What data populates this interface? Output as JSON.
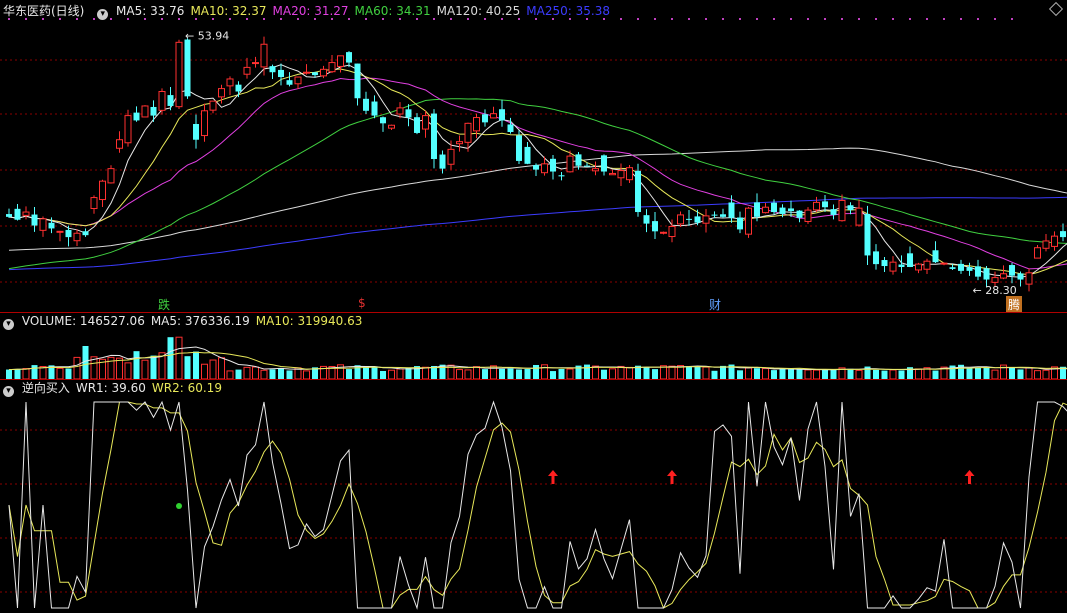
{
  "price_pane": {
    "title": "华东医药(日线)",
    "ma_labels": [
      {
        "text": "MA5: 33.76",
        "color": "#e8e8e8"
      },
      {
        "text": "MA10: 32.37",
        "color": "#e8e85a"
      },
      {
        "text": "MA20: 31.27",
        "color": "#e040e0"
      },
      {
        "text": "MA60: 34.31",
        "color": "#40d040"
      },
      {
        "text": "MA120: 40.25",
        "color": "#d8d8d8"
      },
      {
        "text": "MA250: 35.38",
        "color": "#3c3cff"
      }
    ],
    "high_label": "53.94",
    "low_label": "28.30",
    "markers": [
      {
        "text": "跌",
        "color": "#40d040"
      },
      {
        "text": "$",
        "color": "#e03030"
      },
      {
        "text": "财",
        "color": "#60a0ff"
      },
      {
        "text": "腾",
        "color": "#ffffff",
        "bg": "#c07020"
      }
    ]
  },
  "volume_pane": {
    "labels": [
      {
        "text": "VOLUME: 146527.06",
        "color": "#e8e8e8"
      },
      {
        "text": "MA5: 376336.19",
        "color": "#e8e8e8"
      },
      {
        "text": "MA10: 319940.63",
        "color": "#e8e85a"
      }
    ]
  },
  "indicator_pane": {
    "labels": [
      {
        "text": "逆向买入",
        "color": "#e8e8e8"
      },
      {
        "text": "WR1: 39.60",
        "color": "#e8e8e8"
      },
      {
        "text": "WR2: 60.19",
        "color": "#e8e85a"
      }
    ]
  },
  "colors": {
    "up": "#ff3030",
    "down": "#54ffff",
    "grid": "#8a0000",
    "background": "#000000"
  },
  "chart_data": {
    "type": "candlestick",
    "title": "华东医药(日线)",
    "ylim_price": [
      27.5,
      55.5
    ],
    "closes": [
      35.5,
      35.2,
      36.0,
      34.6,
      35.3,
      34.3,
      34.0,
      33.4,
      33.8,
      33.6,
      37.5,
      39.2,
      40.5,
      43.5,
      46.0,
      45.5,
      47.0,
      46.0,
      48.5,
      47.0,
      53.6,
      48.0,
      43.5,
      46.5,
      47.5,
      48.8,
      49.8,
      48.5,
      51.0,
      51.5,
      53.4,
      50.5,
      50.0,
      49.2,
      50.0,
      50.5,
      50.2,
      50.8,
      51.5,
      52.2,
      51.5,
      47.8,
      46.5,
      46.0,
      45.2,
      45.0,
      46.8,
      45.8,
      44.2,
      46.0,
      41.5,
      40.5,
      42.5,
      43.3,
      45.2,
      45.8,
      45.3,
      46.2,
      45.5,
      44.3,
      41.3,
      41.0,
      40.4,
      41.0,
      40.2,
      39.7,
      41.8,
      40.8,
      40.8,
      40.5,
      40.2,
      40.0,
      40.3,
      40.6,
      36.0,
      34.8,
      34.0,
      33.9,
      34.5,
      35.7,
      35.2,
      34.9,
      35.6,
      35.7,
      35.5,
      35.4,
      34.2,
      36.4,
      35.5,
      36.5,
      36.0,
      35.8,
      36.1,
      35.4,
      36.2,
      37.0,
      36.5,
      35.7,
      37.2,
      36.2,
      36.4,
      31.5,
      30.6,
      30.4,
      30.8,
      30.3,
      30.3,
      30.6,
      30.9,
      30.8,
      30.7,
      30.1,
      29.9,
      29.9,
      29.3,
      29.0,
      29.2,
      29.6,
      29.4,
      29.0,
      29.7,
      32.3,
      33.0,
      33.5,
      33.4,
      33.2,
      32.7
    ],
    "volume_ylim": [
      0,
      1000000
    ],
    "wr_ylim": [
      0,
      100
    ],
    "series": [
      {
        "name": "MA5",
        "value": 33.76
      },
      {
        "name": "MA10",
        "value": 32.37
      },
      {
        "name": "MA20",
        "value": 31.27
      },
      {
        "name": "MA60",
        "value": 34.31
      },
      {
        "name": "MA120",
        "value": 40.25
      },
      {
        "name": "MA250",
        "value": 35.38
      },
      {
        "name": "VOLUME",
        "value": 146527.06
      },
      {
        "name": "WR1",
        "value": 39.6
      },
      {
        "name": "WR2",
        "value": 60.19
      }
    ],
    "annotations": [
      "53.94",
      "28.30"
    ]
  }
}
